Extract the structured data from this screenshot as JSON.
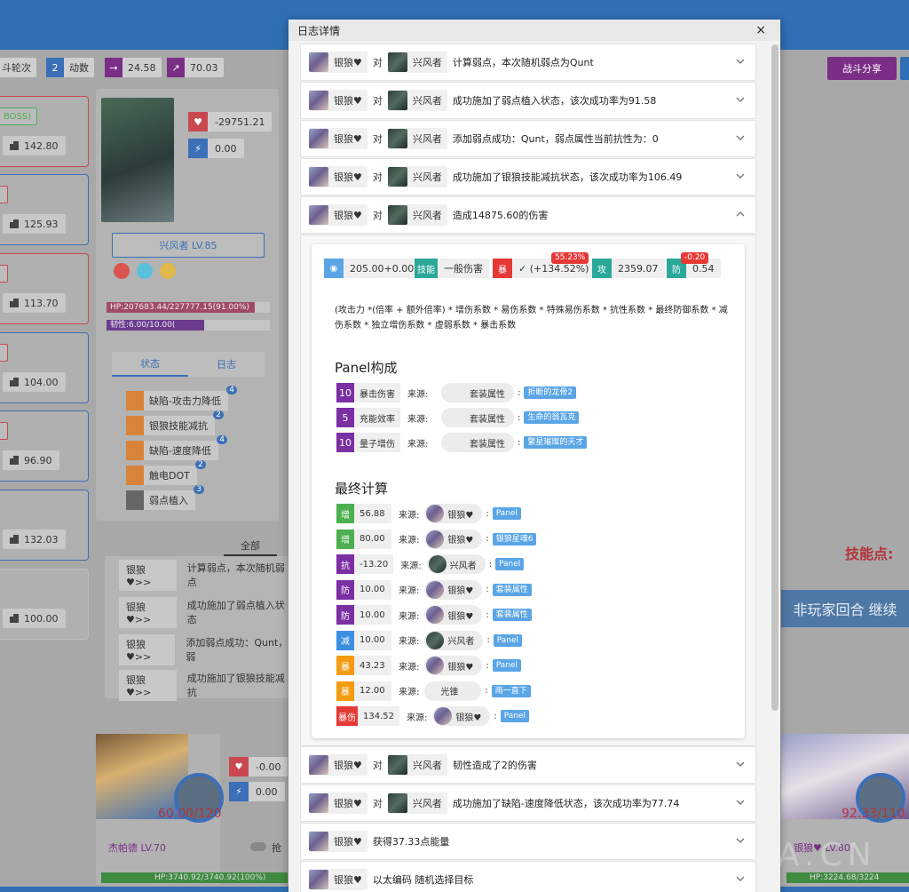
{
  "background": {
    "top_stats": [
      {
        "icon": "rounds-icon",
        "label": "斗轮次"
      },
      {
        "icon": "action-count-icon",
        "value": "2",
        "label": "动数"
      },
      {
        "icon": "arrow-right-icon",
        "value": "24.58"
      },
      {
        "icon": "trend-icon",
        "value": "70.03"
      }
    ],
    "share_label": "战斗分享",
    "enemies": [
      {
        "tag": "BOSS)",
        "speed": "142.80",
        "color": "red"
      },
      {
        "speed": "125.93",
        "color": "blue"
      },
      {
        "speed": "113.70",
        "color": "red"
      },
      {
        "speed": "104.00",
        "color": "blue"
      },
      {
        "speed": "96.90",
        "color": "blue"
      },
      {
        "speed": "132.03",
        "color": "blue"
      },
      {
        "speed": "100.00",
        "color": "none"
      }
    ],
    "detail": {
      "hp_delta": "-29751.21",
      "shield": "0.00",
      "name_level": "兴风者 LV.85",
      "hp_bar": "HP:207683.44/227777.15(91.00%)",
      "hp_fraction": 0.91,
      "toughness_bar": "韧性:6.00/10.00(",
      "toughness_fraction": 0.6,
      "tab_status": "状态",
      "tab_log": "日志",
      "buffs": [
        {
          "name": "缺陷-攻击力降低",
          "count": "4"
        },
        {
          "name": "银狼技能减抗",
          "count": "2"
        },
        {
          "name": "缺陷-速度降低",
          "count": "4"
        },
        {
          "name": "触电DOT",
          "count": "2"
        },
        {
          "name": "弱点植入",
          "count": "3"
        }
      ]
    },
    "log": {
      "tab_all": "全部",
      "lines": [
        {
          "who": "银狼♥>>",
          "text": "计算弱点，本次随机弱点"
        },
        {
          "who": "银狼♥>>",
          "text": "成功施加了弱点植入状态"
        },
        {
          "who": "银狼♥>>",
          "text": "添加弱点成功：Qunt，弱"
        },
        {
          "who": "银狼♥>>",
          "text": "成功施加了银狼技能减抗"
        }
      ]
    },
    "skill_points_label": "技能点:",
    "next_turn_label": "非玩家回合 继续",
    "party": [
      {
        "name": "杰帕德 LV.70",
        "energy": "60.00/120",
        "hp": "HP:3740.92/3740.92(100%)",
        "hp_delta": "-0.00",
        "shield": "0.00",
        "toggle": "抢"
      },
      {
        "name": "银狼♥ LV.80",
        "energy": "92.33/110",
        "hp": "HP:3224.68/3224"
      }
    ],
    "watermark": "A.CN"
  },
  "modal": {
    "title": "日志详情",
    "close": "×",
    "entries_before": [
      {
        "actor": "银狼♥",
        "vs": "对",
        "target": "兴风者",
        "message": "计算弱点，本次随机弱点为Qunt"
      },
      {
        "actor": "银狼♥",
        "vs": "对",
        "target": "兴风者",
        "message": "成功施加了弱点植入状态，该次成功率为91.58"
      },
      {
        "actor": "银狼♥",
        "vs": "对",
        "target": "兴风者",
        "message": "添加弱点成功：Qunt，弱点属性当前抗性为：0"
      },
      {
        "actor": "银狼♥",
        "vs": "对",
        "target": "兴风者",
        "message": "成功施加了银狼技能减抗状态，该次成功率为106.49"
      }
    ],
    "expanded_entry": {
      "actor": "银狼♥",
      "vs": "对",
      "target": "兴风者",
      "message": "造成14875.60的伤害"
    },
    "factors": {
      "base": "205.00+0.00",
      "skill_label": "技能",
      "skill_value": "一般伤害",
      "crit_label": "暴",
      "crit_value": "✓ (+134.52%)",
      "crit_badge": "55.23%",
      "atk_label": "攻",
      "atk_value": "2359.07",
      "def_label": "防",
      "def_value": "0.54",
      "def_badge": "-0.20"
    },
    "formula": "(攻击力 *(倍率 + 额外倍率) * 增伤系数 * 易伤系数 * 特殊易伤系数 * 抗性系数 * 最终防御系数 * 减伤系数 * 独立增伤系数 * 虚弱系数 * 暴击系数",
    "panel_title": "Panel构成",
    "panel_rows": [
      {
        "num": "10",
        "name": "暴击伤害",
        "src_label": "来源:",
        "src": "套装属性",
        "detail": "折断的龙骨2"
      },
      {
        "num": "5",
        "name": "充能效率",
        "src_label": "来源:",
        "src": "套装属性",
        "detail": "生命的翁瓦克"
      },
      {
        "num": "10",
        "name": "量子增伤",
        "src_label": "来源:",
        "src": "套装属性",
        "detail": "繁星璀璨的天才"
      }
    ],
    "final_title": "最终计算",
    "final_rows": [
      {
        "key": "增",
        "color": "#4caf50",
        "value": "56.88",
        "src_label": "来源:",
        "src": "银狼♥",
        "avatar": "silver",
        "detail": "Panel"
      },
      {
        "key": "增",
        "color": "#4caf50",
        "value": "80.00",
        "src_label": "来源:",
        "src": "银狼♥",
        "avatar": "silver",
        "detail": "银狼星魂6"
      },
      {
        "key": "抗",
        "color": "#7b2fa3",
        "value": "-13.20",
        "src_label": "来源:",
        "src": "兴风者",
        "avatar": "wind",
        "detail": "Panel"
      },
      {
        "key": "防",
        "color": "#7b2fa3",
        "value": "10.00",
        "src_label": "来源:",
        "src": "银狼♥",
        "avatar": "silver",
        "detail": "套装属性"
      },
      {
        "key": "防",
        "color": "#7b2fa3",
        "value": "10.00",
        "src_label": "来源:",
        "src": "银狼♥",
        "avatar": "silver",
        "detail": "套装属性"
      },
      {
        "key": "减",
        "color": "#3b8fe0",
        "value": "10.00",
        "src_label": "来源:",
        "src": "兴风者",
        "avatar": "wind",
        "detail": "Panel"
      },
      {
        "key": "暴",
        "color": "#f39c12",
        "value": "43.23",
        "src_label": "来源:",
        "src": "银狼♥",
        "avatar": "silver",
        "detail": "Panel"
      },
      {
        "key": "暴",
        "color": "#f39c12",
        "value": "12.00",
        "src_label": "来源:",
        "src": "光锥",
        "avatar": "none",
        "detail": "雨一直下"
      },
      {
        "key": "暴伤",
        "color": "#e53935",
        "value": "134.52",
        "src_label": "来源:",
        "src": "银狼♥",
        "avatar": "silver",
        "detail": "Panel"
      }
    ],
    "entries_after": [
      {
        "actor": "银狼♥",
        "vs": "对",
        "target": "兴风者",
        "message": "韧性造成了2的伤害"
      },
      {
        "actor": "银狼♥",
        "vs": "对",
        "target": "兴风者",
        "message": "成功施加了缺陷-速度降低状态，该次成功率为77.74"
      },
      {
        "actor": "银狼♥",
        "vs": "",
        "target": "",
        "message": "获得37.33点能量"
      },
      {
        "actor": "银狼♥",
        "vs": "",
        "target": "",
        "message": "以太编码 随机选择目标"
      }
    ],
    "colors": {
      "purple": "#7b2fa3",
      "blue": "#5aa5e6",
      "red": "#e53935",
      "teal": "#2aa89a",
      "green": "#4caf50",
      "orange": "#f39c12"
    }
  }
}
